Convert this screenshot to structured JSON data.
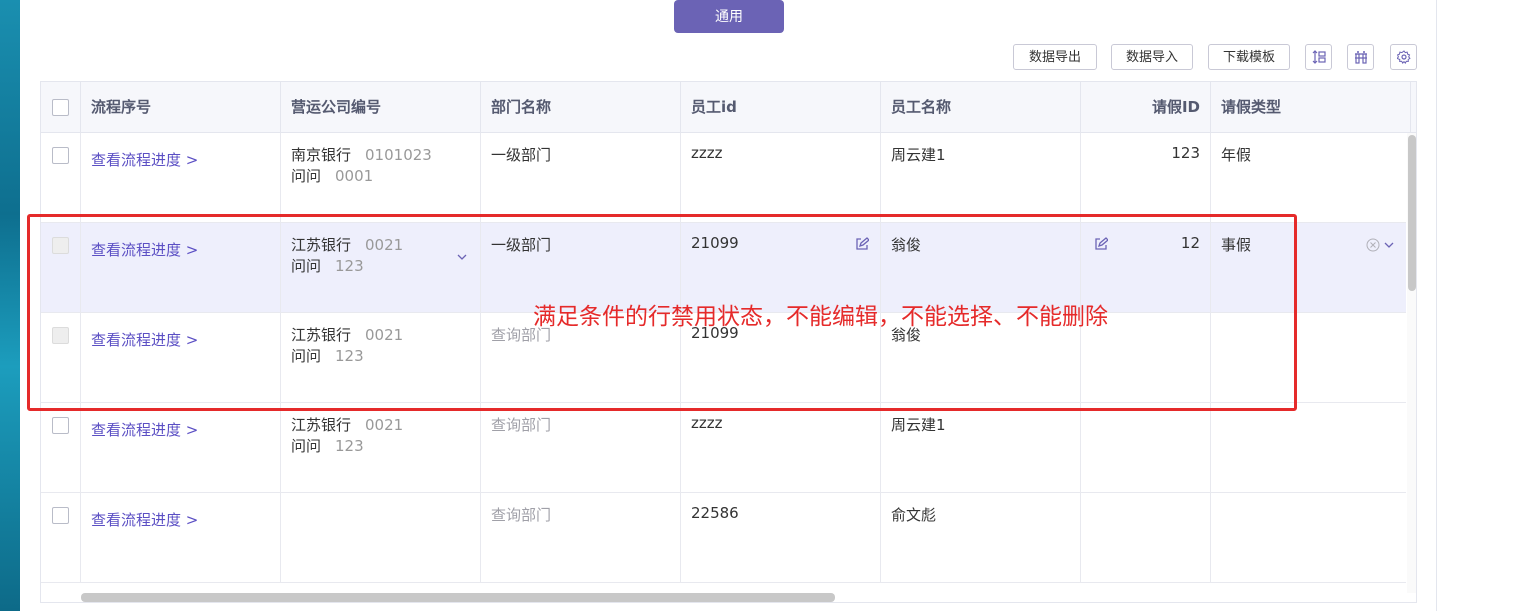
{
  "tab": {
    "label": "通用"
  },
  "toolbar": {
    "export_label": "数据导出",
    "import_label": "数据导入",
    "template_label": "下载模板",
    "icons": [
      "column-height-icon",
      "column-settings-icon",
      "gear-icon"
    ]
  },
  "table": {
    "headers": {
      "flow_no": "流程序号",
      "company_code": "营运公司编号",
      "dept_name": "部门名称",
      "emp_id": "员工id",
      "emp_name": "员工名称",
      "leave_id": "请假ID",
      "leave_type": "请假类型"
    },
    "rows": [
      {
        "link": "查看流程进度 >",
        "company": "南京银行",
        "company_code": "0101023",
        "company2": "问问",
        "company2_code": "0001",
        "dept": "一级部门",
        "emp_id": "zzzz",
        "emp_name": "周云建1",
        "leave_id": "123",
        "leave_type": "年假"
      },
      {
        "link": "查看流程进度 >",
        "company": "江苏银行",
        "company_code": "0021",
        "company2": "问问",
        "company2_code": "123",
        "dept": "一级部门",
        "emp_id": "21099",
        "emp_name": "翁俊",
        "leave_id": "12",
        "leave_type": "事假"
      },
      {
        "link": "查看流程进度 >",
        "company": "江苏银行",
        "company_code": "0021",
        "company2": "问问",
        "company2_code": "123",
        "dept": "查询部门",
        "emp_id": "21099",
        "emp_name": "翁俊",
        "leave_id": "",
        "leave_type": ""
      },
      {
        "link": "查看流程进度 >",
        "company": "江苏银行",
        "company_code": "0021",
        "company2": "问问",
        "company2_code": "123",
        "dept": "查询部门",
        "emp_id": "zzzz",
        "emp_name": "周云建1",
        "leave_id": "",
        "leave_type": ""
      },
      {
        "link": "查看流程进度 >",
        "company": "",
        "company_code": "",
        "company2": "",
        "company2_code": "",
        "dept": "查询部门",
        "emp_id": "22586",
        "emp_name": "俞文彪",
        "leave_id": "",
        "leave_type": ""
      }
    ]
  },
  "annotation": {
    "text": "满足条件的行禁用状态，不能编辑，不能选择、不能删除"
  },
  "colors": {
    "accent": "#6b63b5",
    "link": "#5b4fc4",
    "annotation": "#e52a2a",
    "highlight_row": "#eeeffc"
  }
}
